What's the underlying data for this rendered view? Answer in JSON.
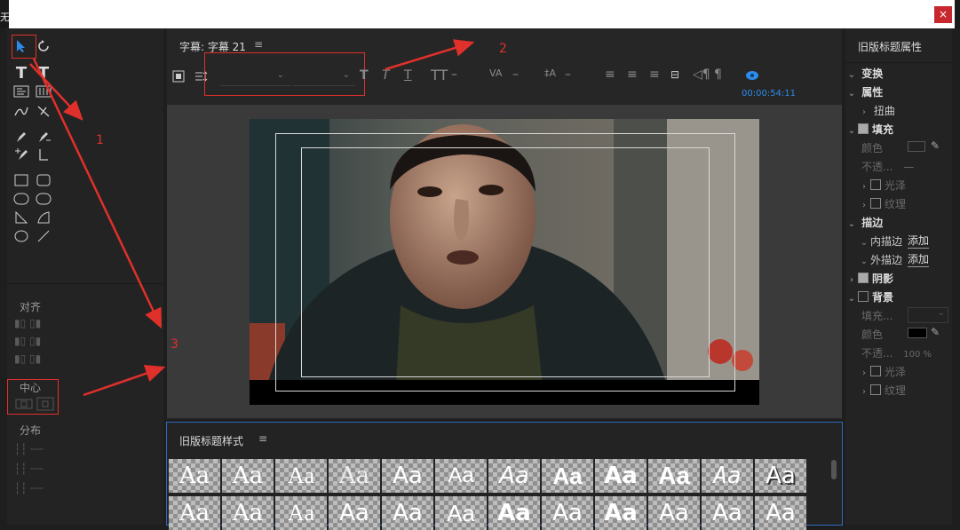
{
  "window": {
    "close_glyph": "×",
    "edge_left_text": "无"
  },
  "tools": {
    "selection": "selection-tool",
    "rotate": "rotate-tool",
    "type": "T",
    "vertical_type": "T"
  },
  "align": {
    "label": "对齐"
  },
  "center": {
    "label": "中心"
  },
  "distribute": {
    "label": "分布"
  },
  "title_panel": {
    "title": "字幕: 字幕 21",
    "menu_glyph": "≡",
    "timecode": "00:00:54:11",
    "font_family_placeholder": "",
    "font_style_placeholder": ""
  },
  "styles_panel": {
    "title": "旧版标题样式",
    "menu_glyph": "≡",
    "tiles": [
      "Aa",
      "Aa",
      "Aa",
      "Aa",
      "Aa",
      "Aa",
      "Aa",
      "Aa",
      "Aa",
      "Aa",
      "Aa",
      "Aa"
    ]
  },
  "properties_panel": {
    "title": "旧版标题属性",
    "transform": "变换",
    "attributes": "属性",
    "distort": "扭曲",
    "fill": "填充",
    "fill_color": "颜色",
    "opacity": "不透...",
    "opacity_value": "—",
    "sheen": "光泽",
    "texture": "纹理",
    "stroke": "描边",
    "inner_stroke": "内描边",
    "outer_stroke": "外描边",
    "add": "添加",
    "shadow": "阴影",
    "background": "背景",
    "fill_type": "填充...",
    "bg_color": "颜色",
    "bg_opacity": "不透...",
    "bg_opacity_value": "100 %",
    "bg_sheen": "光泽",
    "bg_texture": "纹理"
  },
  "annotations": [
    "1",
    "2",
    "3"
  ],
  "colors": {
    "accent_blue": "#2d8ceb",
    "annotation_red": "#e0302b",
    "close_red": "#c8272d"
  }
}
